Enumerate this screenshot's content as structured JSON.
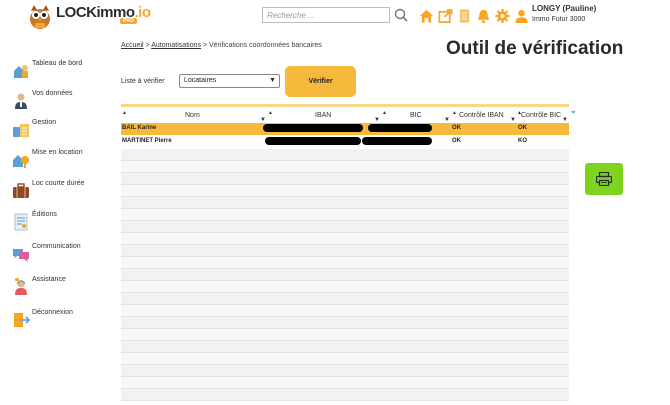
{
  "header": {
    "logo_text": "LOCKimmo",
    "logo_suffix": ".io",
    "logo_badge": "PRO",
    "search": {
      "placeholder": "Recherche ..."
    },
    "icons": [
      "home-icon",
      "external-link-icon",
      "document-icon",
      "bell-icon",
      "gear-icon",
      "user-icon"
    ],
    "user": {
      "name": "LONGY (Pauline)",
      "company": "Immo Futur 3000"
    }
  },
  "sidebar": {
    "items": [
      {
        "label": "Tableau de bord",
        "icon": "dashboard-icon"
      },
      {
        "label": "Vos données",
        "icon": "person-icon"
      },
      {
        "label": "Gestion",
        "icon": "management-icon"
      },
      {
        "label": "Mise en location",
        "icon": "rental-icon"
      },
      {
        "label": "Loc courte durée",
        "icon": "suitcase-icon"
      },
      {
        "label": "Éditions",
        "icon": "editions-icon"
      },
      {
        "label": "Communication",
        "icon": "chat-icon"
      },
      {
        "label": "Assistance",
        "icon": "support-icon"
      },
      {
        "label": "Déconnexion",
        "icon": "logout-icon"
      }
    ]
  },
  "breadcrumb": {
    "home": "Accueil",
    "sep1": ">",
    "section": "Automatisations",
    "sep2": ">",
    "current": "Vérifications coordonnées bancaires"
  },
  "page": {
    "title": "Outil de vérification",
    "list_label": "Liste à vérifier",
    "select_value": "Locataires",
    "verify_label": "Vérifier"
  },
  "table": {
    "columns": [
      "Nom",
      "IBAN",
      "BIC",
      "Contrôle IBAN",
      "Contrôle BIC"
    ],
    "rows": [
      {
        "name": "BAIL Karine",
        "iban_check": "OK",
        "bic_check": "OK",
        "selected": true
      },
      {
        "name": "MARTINET Pierre",
        "iban_check": "OK",
        "bic_check": "KO",
        "selected": false
      }
    ]
  },
  "colors": {
    "accent": "#f6b93b",
    "print": "#7ed321",
    "ok": "#1a7a1a",
    "ko": "#cc1d1d"
  }
}
